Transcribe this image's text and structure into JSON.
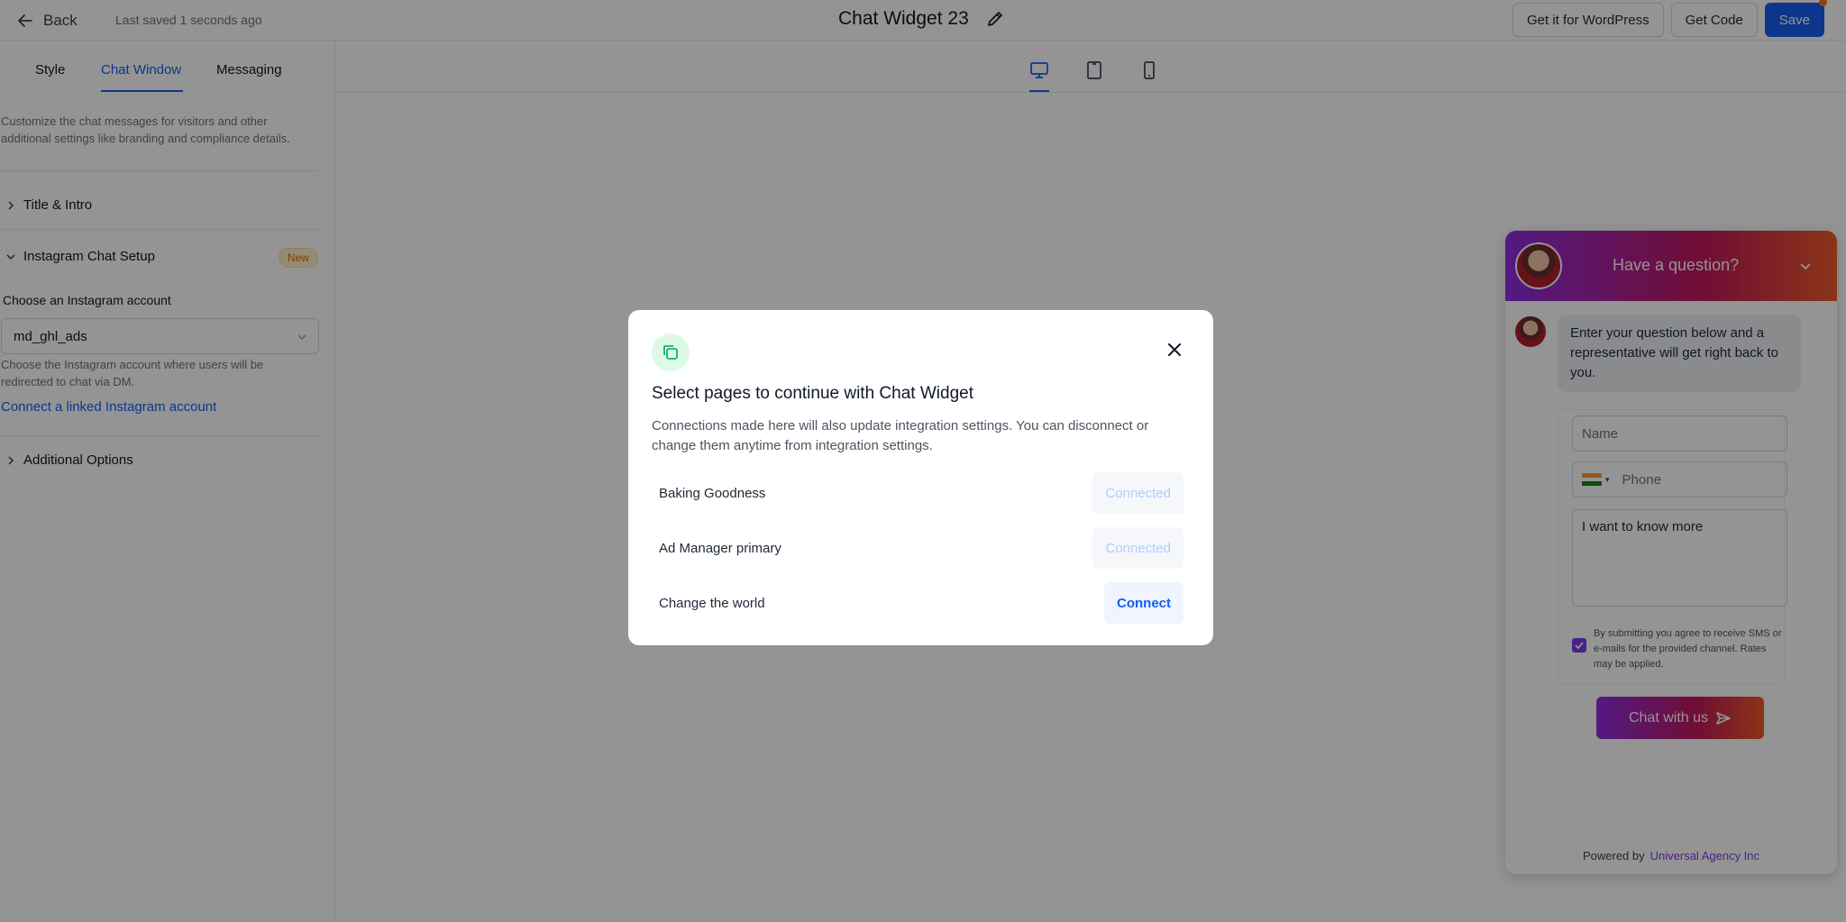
{
  "topbar": {
    "back_label": "Back",
    "last_saved": "Last saved 1 seconds ago",
    "widget_title": "Chat Widget 23",
    "wordpress_label": "Get it for WordPress",
    "get_code_label": "Get Code",
    "save_label": "Save"
  },
  "tabs": [
    {
      "label": "Style"
    },
    {
      "label": "Chat Window"
    },
    {
      "label": "Messaging"
    }
  ],
  "panel": {
    "description": "Customize the chat messages for visitors and other additional settings like branding and compliance details.",
    "title_intro": "Title & Intro",
    "instagram_setup": "Instagram Chat Setup",
    "new_badge": "New",
    "choose_account_label": "Choose an Instagram account",
    "selected_account": "md_ghl_ads",
    "account_hint": "Choose the Instagram account where users will be redirected to chat via DM.",
    "connect_link": "Connect a linked Instagram account",
    "additional_options": "Additional Options"
  },
  "chat_widget": {
    "header_title": "Have a question?",
    "intro_message": "Enter your question below and a representative will get right back to you.",
    "name_placeholder": "Name",
    "phone_placeholder": "Phone",
    "message_value": "I want to know more",
    "consent_text": "By submitting you agree to receive SMS or e-mails for the provided channel. Rates may be applied.",
    "submit_label": "Chat with us",
    "powered_by": "Powered by",
    "brand_name": "Universal Agency Inc"
  },
  "modal": {
    "title": "Select pages to continue with Chat Widget",
    "description": "Connections made here will also update integration settings. You can disconnect or change them anytime from integration settings.",
    "pages": [
      {
        "name": "Baking Goodness",
        "status": "Connected"
      },
      {
        "name": "Ad Manager primary",
        "status": "Connected"
      },
      {
        "name": "Change the world",
        "status": "Connect"
      }
    ]
  },
  "colors": {
    "primary": "#155eef",
    "gradient_start": "#8e2de2",
    "gradient_end": "#f05a28",
    "badge_text": "#dc6803"
  }
}
